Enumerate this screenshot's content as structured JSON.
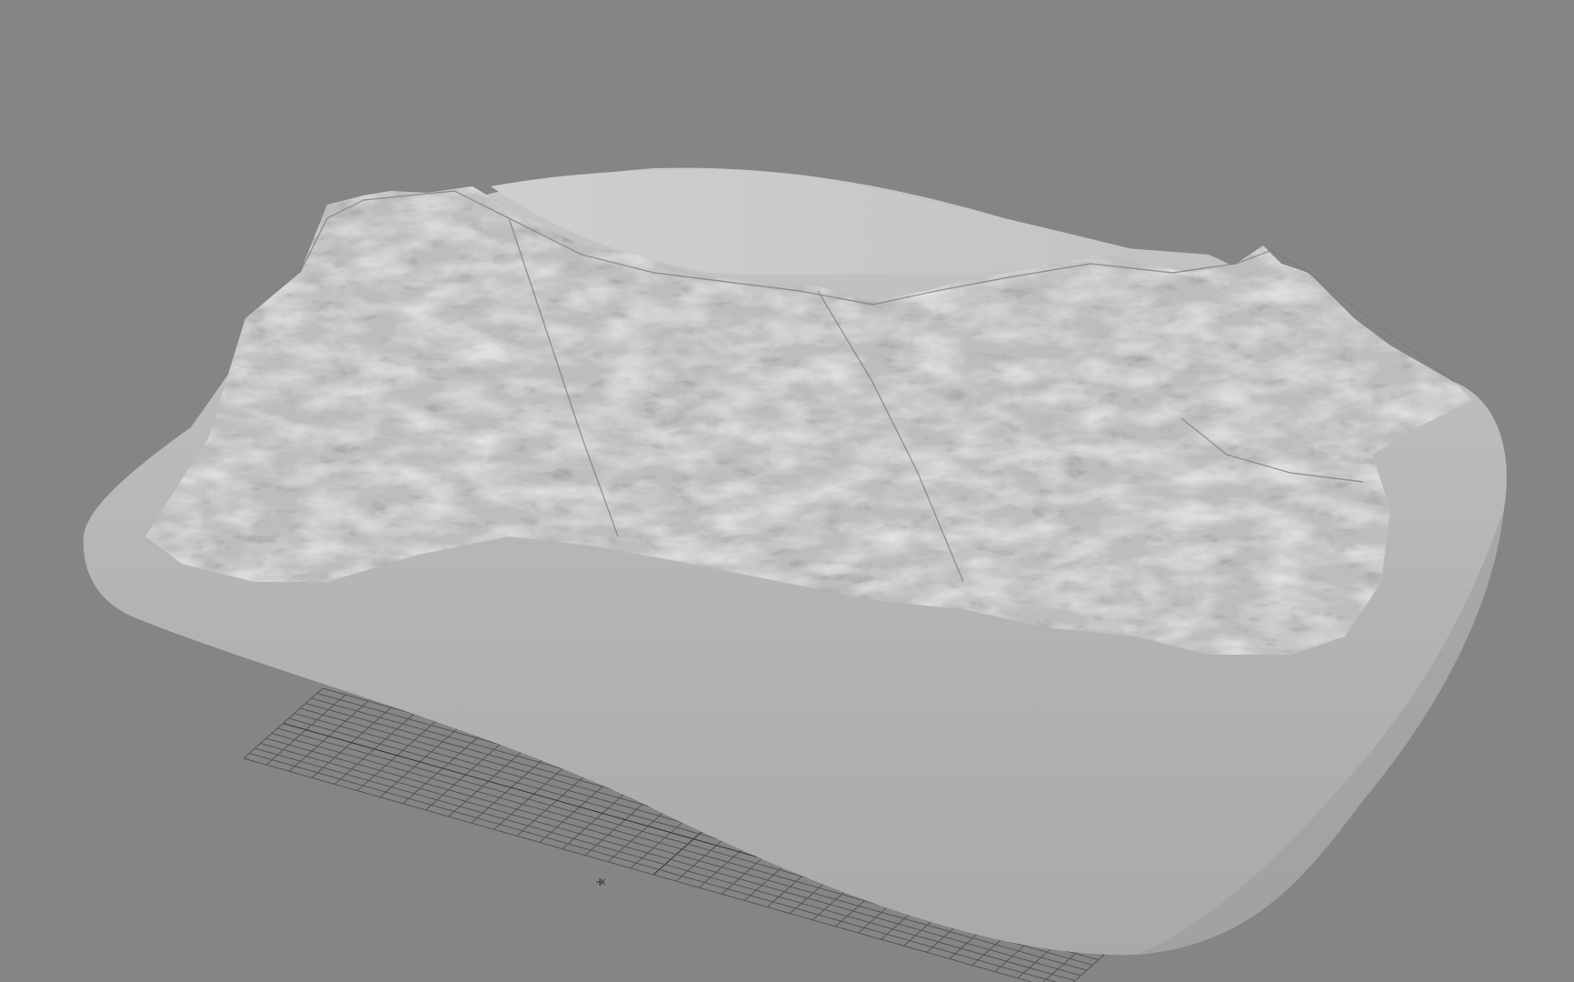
{
  "viewport": {
    "background_color": "#858585",
    "mesh_color": "#b0b0b0",
    "mesh_highlight_color": "#d2d2d2",
    "mesh_shadow_color": "#6e6e6e",
    "grid_color": "#555555"
  },
  "ground_grid": {
    "visible": true
  },
  "axis_marker": {
    "label": "x"
  },
  "model": {
    "icon": "terrain-mesh"
  }
}
